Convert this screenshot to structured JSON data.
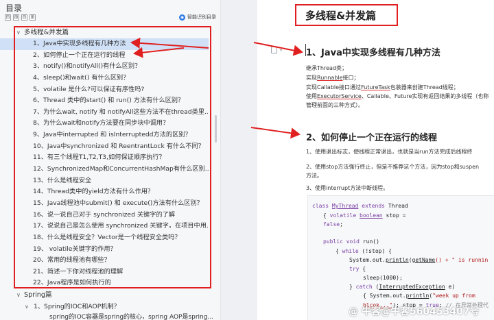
{
  "toc": {
    "title": "目录",
    "tools": [
      "⊟",
      "⊞",
      "⊟",
      "⊞"
    ],
    "smart_button": "智能识别目录",
    "sections": [
      {
        "label": "多线程&并发篇",
        "items": [
          "1、Java中实现多线程有几种方法",
          "2、如何停止一个正在运行的线程",
          "3、notify()和notifyAll()有什么区别？",
          "4、sleep()和wait() 有什么区别？",
          "5、volatile 是什么?可以保证有序性吗?",
          "6、Thread 类中的start() 和 run() 方法有什么区别？",
          "7、为什么wait, notify 和 notifyAll这些方法不在thread类里...",
          "8、为什么wait和notify方法要在同步块中调用？",
          "9、Java中interrupted 和 isInterruptedd方法的区别？",
          "10、Java中synchronized 和 ReentrantLock 有什么不同？",
          "11、有三个线程T1,T2,T3,如何保证顺序执行？",
          "12、SynchronizedMap和ConcurrentHashMap有什么区别...",
          "13、什么是线程安全",
          "14、Thread类中的yield方法有什么作用？",
          "15、Java线程池中submit() 和 execute()方法有什么区别？",
          "16、说一说自己对于 synchronized 关键字的了解",
          "17、说说自己是怎么使用 synchronized 关键字，在项目中用...",
          "18、什么是线程安全？Vector是一个线程安全类吗？",
          "19、 volatile关键字的作用？",
          "20、常用的线程池有哪些？",
          "21、简述一下你对线程池的理解",
          "22、Java程序是如何执行的"
        ]
      },
      {
        "label": "Spring篇",
        "sub_label": "1、Spring的IOC和AOP机制？",
        "sub_item": "spring的IOC容器是spring的核心，spring AOP是spring..."
      }
    ]
  },
  "doc": {
    "page_title": "多线程&并发篇",
    "h1": "1、Java中实现多线程有几种方法",
    "p1": [
      "继承Thread类；",
      "实现",
      "Runnable",
      "接口；",
      "实现Callable接口通过",
      "FutureTask",
      "包装器来创建Thread线程；",
      "使用",
      "ExecutorService",
      "、Callable、Future实现有返回结果的多线程（也称",
      "管理前面的三种方式）。"
    ],
    "h2": "2、如何停止一个正在运行的线程",
    "p2": "1、使用退出标志，使线程正常退出，也就是当run方法完成后线程终",
    "p3a": "2、使用stop方法强行终止，但是不推荐这个方法，因为stop和suspen",
    "p3b": "方法。",
    "p4": "3、使用interrupt方法中断线程。",
    "code": {
      "l1": [
        "class ",
        "MyThread",
        " extends ",
        "Thread"
      ],
      "l2": [
        "{ ",
        "volatile ",
        "boolean",
        " stop ="
      ],
      "l3": [
        "false",
        ";"
      ],
      "l4": [
        "public ",
        "void ",
        "run()"
      ],
      "l5": [
        "{ ",
        "while ",
        "(!stop) {"
      ],
      "l6": [
        "System.out.",
        "println",
        "(",
        "getName",
        "() + \" is runnin"
      ],
      "l7": [
        "try ",
        "{"
      ],
      "l8": [
        "sleep(1000);"
      ],
      "l9": [
        "} ",
        "catch ",
        "(",
        "InterruptedException",
        " e)"
      ],
      "l10": [
        "{ System.out.",
        "println",
        "(",
        "\"week up from"
      ],
      "l11": [
        "blcok...\"",
        "); stop = ",
        "true",
        "; ",
        "// 在异常处理代"
      ]
    },
    "watermark": "@ 牛客@牛客560453407号"
  },
  "colors": {
    "annotation_red": "#e02020",
    "active_item_bg": "#cfe0f7",
    "smart_icon": "#2f7ae5"
  }
}
